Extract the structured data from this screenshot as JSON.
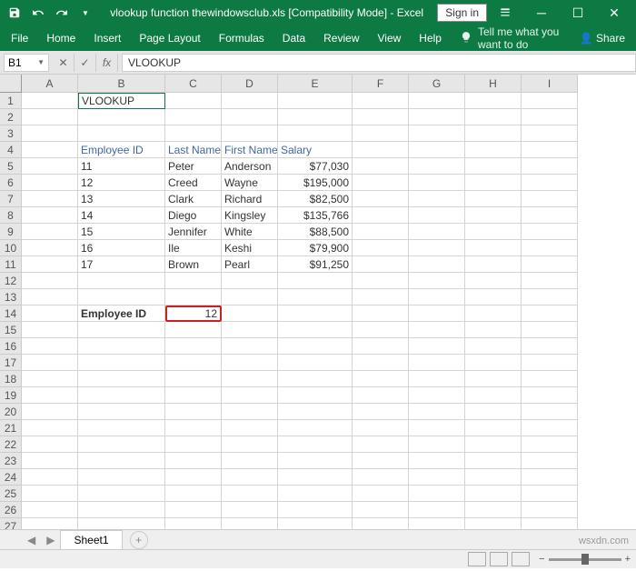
{
  "title": "vlookup function thewindowsclub.xls  [Compatibility Mode]  -  Excel",
  "sign_in": "Sign in",
  "ribbon": {
    "file": "File",
    "home": "Home",
    "insert": "Insert",
    "page_layout": "Page Layout",
    "formulas": "Formulas",
    "data": "Data",
    "review": "Review",
    "view": "View",
    "help": "Help",
    "tell_me": "Tell me what you want to do",
    "share": "Share"
  },
  "name_box": "B1",
  "formula": "VLOOKUP",
  "columns": [
    "A",
    "B",
    "C",
    "D",
    "E",
    "F",
    "G",
    "H",
    "I"
  ],
  "cells": {
    "B1": "VLOOKUP",
    "B4": "Employee ID",
    "C4": "Last Name",
    "D4": "First Name",
    "E4": "Salary",
    "B5": "11",
    "C5": "Peter",
    "D5": "Anderson",
    "E5": "$77,030",
    "B6": "12",
    "C6": "Creed",
    "D6": "Wayne",
    "E6": "$195,000",
    "B7": "13",
    "C7": "Clark",
    "D7": "Richard",
    "E7": "$82,500",
    "B8": "14",
    "C8": "Diego",
    "D8": "Kingsley",
    "E8": "$135,766",
    "B9": "15",
    "C9": "Jennifer",
    "D9": "White",
    "E9": "$88,500",
    "B10": "16",
    "C10": "Ile",
    "D10": "Keshi",
    "E10": "$79,900",
    "B11": "17",
    "C11": "Brown",
    "D11": "Pearl",
    "E11": "$91,250",
    "B14": "Employee ID",
    "C14": "12"
  },
  "sheet": "Sheet1",
  "watermark": "wsxdn.com"
}
